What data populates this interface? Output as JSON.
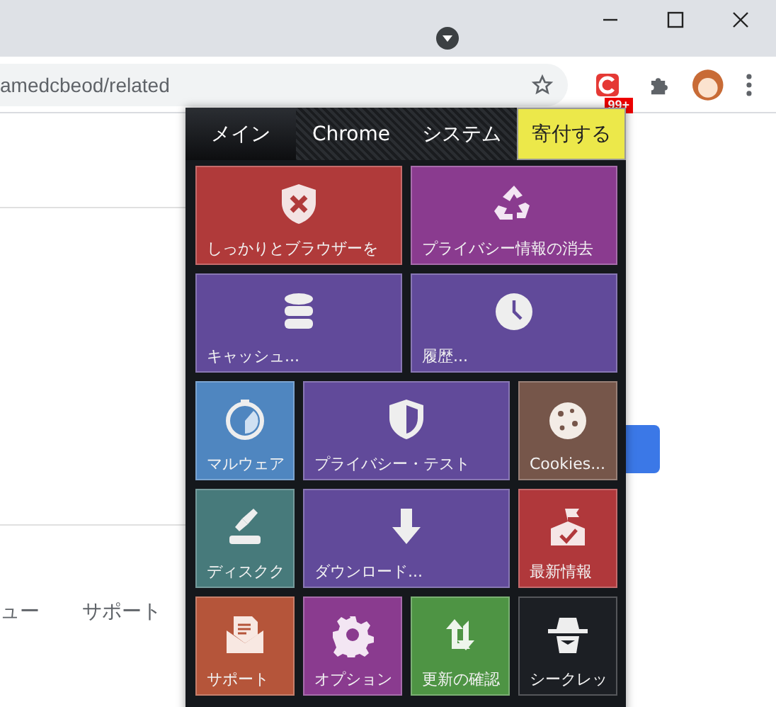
{
  "browser": {
    "address": "amedcbeod/related",
    "extension_badge": "99+"
  },
  "page": {
    "links": [
      "ュー",
      "サポート"
    ]
  },
  "popup": {
    "tabs": [
      {
        "label": "メイン",
        "kind": "tab",
        "selected": true
      },
      {
        "label": "Chrome",
        "kind": "tab",
        "selected": false
      },
      {
        "label": "システム",
        "kind": "tab",
        "selected": false
      },
      {
        "label": "寄付する",
        "kind": "donate",
        "selected": false
      }
    ],
    "tiles": [
      {
        "label": "しっかりとブラウザーを",
        "color": "#b03a3a",
        "wide": true
      },
      {
        "label": "プライバシー情報の消去",
        "color": "#8a3b8f",
        "wide": true
      },
      {
        "label": "キャッシュ...",
        "color": "#614a9a",
        "wide": true
      },
      {
        "label": "履歴...",
        "color": "#614a9a",
        "wide": true
      },
      {
        "label": "マルウェア",
        "color": "#4f86c0",
        "wide": false
      },
      {
        "label": "プライバシー・テスト",
        "color": "#614a9a",
        "wide": true
      },
      {
        "label": "Cookies...",
        "color": "#76564a",
        "wide": false
      },
      {
        "label": "ディスクク",
        "color": "#477a7b",
        "wide": false
      },
      {
        "label": "ダウンロード...",
        "color": "#614a9a",
        "wide": true
      },
      {
        "label": "最新情報",
        "color": "#b0383b",
        "wide": false
      },
      {
        "label": "サポート",
        "color": "#b5553a",
        "wide": false
      },
      {
        "label": "オプション",
        "color": "#8a3b8f",
        "wide": false
      },
      {
        "label": "更新の確認",
        "color": "#4e9444",
        "wide": false
      },
      {
        "label": "シークレッ",
        "color": "#1c1f24",
        "wide": false
      }
    ]
  }
}
